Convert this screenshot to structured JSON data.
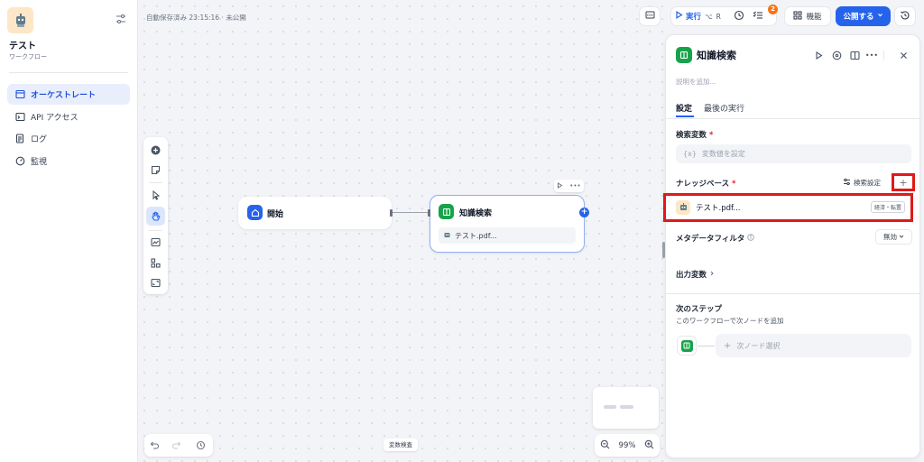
{
  "app": {
    "name": "テスト",
    "type": "ワークフロー"
  },
  "sidebar": {
    "items": [
      {
        "label": "オーケストレート",
        "icon": "layout-icon"
      },
      {
        "label": "API アクセス",
        "icon": "terminal-icon"
      },
      {
        "label": "ログ",
        "icon": "log-icon"
      },
      {
        "label": "監視",
        "icon": "monitor-icon"
      }
    ]
  },
  "canvas": {
    "autosave": "自動保存済み 23:15:16 · 未公開",
    "start_node": {
      "title": "開始"
    },
    "knowledge_node": {
      "title": "知識検索",
      "file": "テスト.pdf..."
    },
    "variable_inspect": "変数検査",
    "zoom": "99%"
  },
  "topbar": {
    "run_label": "実行",
    "run_shortcut_1": "⌥",
    "run_shortcut_2": "R",
    "checklist_badge": "2",
    "features_label": "機能",
    "publish_label": "公開する"
  },
  "panel": {
    "title": "知識検索",
    "description_placeholder": "説明を追加...",
    "tabs": [
      "設定",
      "最後の実行"
    ],
    "query_label": "検索変数",
    "query_placeholder": "変数値を設定",
    "query_prefix": "{x}",
    "kb_label": "ナレッジベース",
    "search_settings": "検索設定",
    "add_symbol": "+",
    "kb_item": {
      "name": "テスト.pdf...",
      "tag": "経済・転置"
    },
    "metadata_label": "メタデータフィルタ",
    "metadata_value": "無効",
    "output_label": "出力変数",
    "next_title": "次のステップ",
    "next_desc": "このワークフローで次ノードを追加",
    "next_select": "次ノード選択"
  },
  "colors": {
    "accent": "#2563eb",
    "highlight": "#e11919",
    "knowledge_icon": "#16a34a",
    "badge": "#f97316"
  }
}
